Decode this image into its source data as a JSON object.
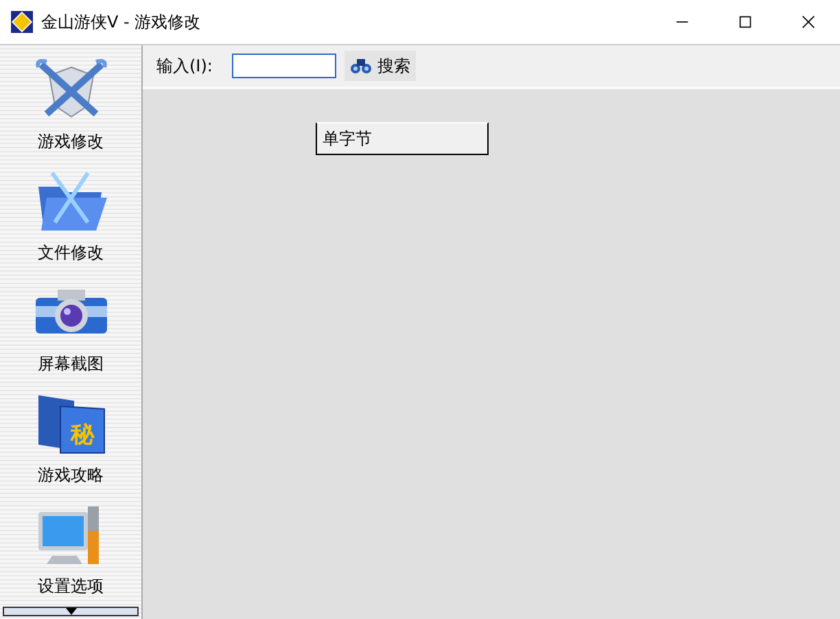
{
  "window": {
    "title": "金山游侠V - 游戏修改"
  },
  "sidebar": {
    "items": [
      {
        "kind": "swords",
        "label": "游戏修改"
      },
      {
        "kind": "folder",
        "label": "文件修改"
      },
      {
        "kind": "camera",
        "label": "屏幕截图"
      },
      {
        "kind": "book",
        "label": "游戏攻略",
        "icon_text": "秘"
      },
      {
        "kind": "monitor",
        "label": "设置选项"
      }
    ]
  },
  "toolbar": {
    "input_label": "输入(I):",
    "search_button": "搜索"
  },
  "popup": {
    "items": [
      "单字节"
    ]
  }
}
